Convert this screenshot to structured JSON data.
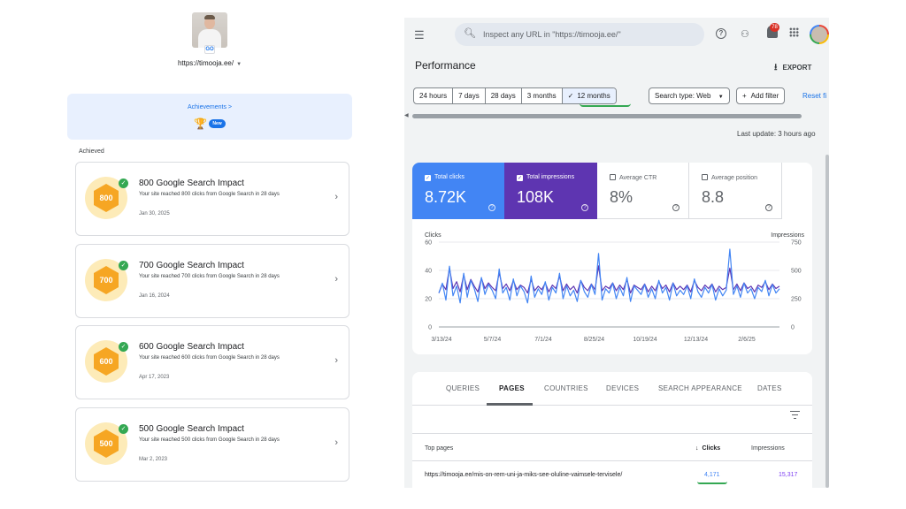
{
  "left_panel": {
    "site_url": "https://timooja.ee/",
    "achievements_link": "Achievements >",
    "new_badge": "New",
    "achieved_label": "Achieved",
    "cards": [
      {
        "badge": "800",
        "title": "800 Google Search Impact",
        "desc": "Your site reached 800 clicks from Google Search in 28 days",
        "date": "Jan 30, 2025"
      },
      {
        "badge": "700",
        "title": "700 Google Search Impact",
        "desc": "Your site reached 700 clicks from Google Search in 28 days",
        "date": "Jan 16, 2024"
      },
      {
        "badge": "600",
        "title": "600 Google Search Impact",
        "desc": "Your site reached 600 clicks from Google Search in 28 days",
        "date": "Apr 17, 2023"
      },
      {
        "badge": "500",
        "title": "500 Google Search Impact",
        "desc": "Your site reached 500 clicks from Google Search in 28 days",
        "date": "Mar 2, 2023"
      }
    ]
  },
  "topbar": {
    "search_placeholder": "Inspect any URL in \"https://timooja.ee/\"",
    "notification_count": "78"
  },
  "performance": {
    "title": "Performance",
    "export_label": "EXPORT",
    "ranges": [
      "24 hours",
      "7 days",
      "28 days",
      "3 months",
      "12 months"
    ],
    "active_range": "12 months",
    "search_type": "Search type: Web",
    "add_filter": "Add filter",
    "reset": "Reset fi",
    "last_update": "Last update: 3 hours ago"
  },
  "metrics": {
    "clicks": {
      "label": "Total clicks",
      "value": "8.72K"
    },
    "impressions": {
      "label": "Total impressions",
      "value": "108K"
    },
    "ctr": {
      "label": "Average CTR",
      "value": "8%"
    },
    "position": {
      "label": "Average position",
      "value": "8.8"
    }
  },
  "chart_data": {
    "type": "line",
    "x_tick_labels": [
      "3/13/24",
      "5/7/24",
      "7/1/24",
      "8/25/24",
      "10/19/24",
      "12/13/24",
      "2/6/25"
    ],
    "left_axis": {
      "label": "Clicks",
      "ticks": [
        0,
        20,
        40,
        60
      ],
      "ylim": [
        0,
        60
      ]
    },
    "right_axis": {
      "label": "Impressions",
      "ticks": [
        0,
        250,
        500,
        750
      ],
      "ylim": [
        0,
        750
      ]
    },
    "series": [
      {
        "name": "Clicks",
        "axis": "left",
        "color": "#4285f4",
        "values": [
          24,
          31,
          19,
          43,
          22,
          29,
          17,
          38,
          21,
          33,
          27,
          18,
          35,
          23,
          30,
          26,
          20,
          41,
          24,
          28,
          19,
          34,
          22,
          29,
          25,
          17,
          36,
          21,
          27,
          23,
          32,
          19,
          28,
          24,
          38,
          20,
          29,
          22,
          26,
          18,
          33,
          25,
          21,
          30,
          23,
          52,
          19,
          27,
          24,
          31,
          20,
          28,
          22,
          35,
          18,
          29,
          26,
          23,
          30,
          21,
          27,
          20,
          33,
          24,
          28,
          19,
          31,
          22,
          26,
          23,
          29,
          20,
          34,
          25,
          21,
          28,
          24,
          30,
          19,
          27,
          22,
          26,
          55,
          23,
          29,
          21,
          31,
          24,
          27,
          20,
          28,
          25,
          33,
          22,
          30,
          24,
          27
        ]
      },
      {
        "name": "Impressions",
        "axis": "right",
        "color": "#5e35b1",
        "values": [
          300,
          380,
          330,
          520,
          340,
          400,
          310,
          460,
          330,
          420,
          360,
          310,
          430,
          340,
          390,
          350,
          320,
          480,
          340,
          380,
          320,
          410,
          330,
          370,
          350,
          300,
          420,
          320,
          360,
          330,
          390,
          310,
          370,
          340,
          450,
          320,
          380,
          330,
          360,
          300,
          410,
          350,
          320,
          380,
          330,
          540,
          320,
          360,
          340,
          390,
          320,
          370,
          330,
          420,
          300,
          370,
          350,
          330,
          380,
          310,
          360,
          320,
          400,
          340,
          370,
          310,
          390,
          330,
          360,
          330,
          370,
          310,
          410,
          350,
          320,
          370,
          340,
          380,
          310,
          360,
          330,
          350,
          520,
          330,
          380,
          320,
          390,
          340,
          360,
          310,
          370,
          350,
          400,
          330,
          380,
          340,
          360
        ]
      }
    ]
  },
  "table": {
    "tabs": [
      "QUERIES",
      "PAGES",
      "COUNTRIES",
      "DEVICES",
      "SEARCH APPEARANCE",
      "DATES"
    ],
    "active_tab": "PAGES",
    "col_top_pages": "Top pages",
    "col_clicks": "Clicks",
    "col_impressions": "Impressions",
    "rows": [
      {
        "url": "https://timooja.ee/mis-on-rem-uni-ja-miks-see-oluline-vaimsele-tervisele/",
        "clicks": "4,171",
        "impressions": "15,317"
      }
    ]
  }
}
